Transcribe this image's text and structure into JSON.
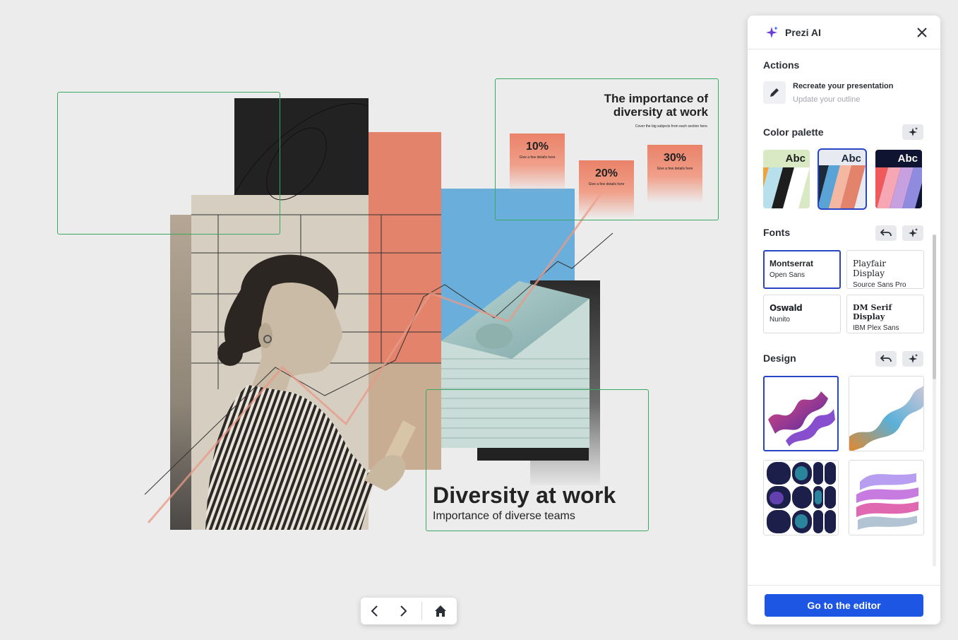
{
  "canvas": {
    "summary_slide": {
      "title": "The importance of diversity at work",
      "subtitle": "Cover the big subjects from each section here.",
      "stats": [
        {
          "value": "10%",
          "caption": "Give a few details here"
        },
        {
          "value": "20%",
          "caption": "Give a few details here"
        },
        {
          "value": "30%",
          "caption": "Give a few details here"
        }
      ]
    },
    "title_slide": {
      "title": "Diversity at work",
      "subtitle": "Importance of diverse teams"
    }
  },
  "nav": {
    "prev_icon": "chevron-left-icon",
    "next_icon": "chevron-right-icon",
    "home_icon": "home-icon"
  },
  "panel": {
    "title": "Prezi AI",
    "actions": {
      "heading": "Actions",
      "items": [
        {
          "title": "Recreate your presentation",
          "subtitle": "Update your outline",
          "icon": "pencil-icon"
        }
      ]
    },
    "color_palette": {
      "heading": "Color palette",
      "swatch_label": "Abc",
      "selected_index": 1
    },
    "fonts": {
      "heading": "Fonts",
      "selected_index": 0,
      "pairs": [
        {
          "heading_font": "Montserrat",
          "body_font": "Open Sans"
        },
        {
          "heading_font": "Playfair Display",
          "body_font": "Source Sans Pro"
        },
        {
          "heading_font": "Oswald",
          "body_font": "Nunito"
        },
        {
          "heading_font": "DM Serif Display",
          "body_font": "IBM Plex Sans"
        }
      ]
    },
    "design": {
      "heading": "Design",
      "selected_index": 0
    },
    "cta_label": "Go to the editor"
  },
  "colors": {
    "accent": "#1e56e4",
    "selection": "#2845c8",
    "frame_green": "#3aa860",
    "coral": "#e4836b",
    "sky_blue": "#6aafdb",
    "beige": "#d6cfc1"
  }
}
